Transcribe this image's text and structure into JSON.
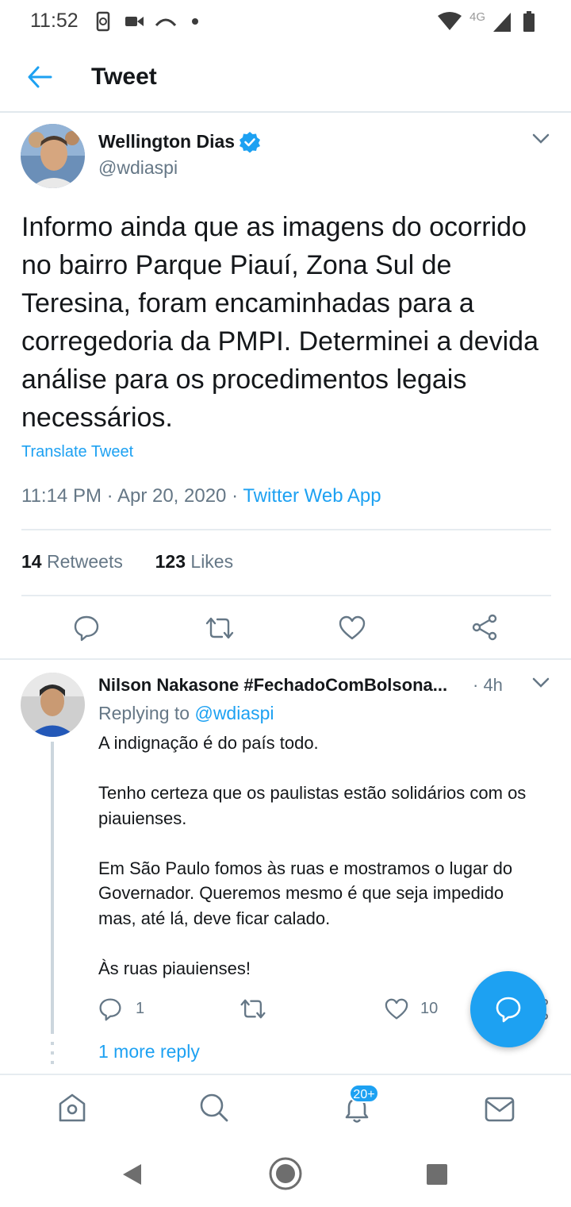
{
  "status_bar": {
    "time": "11:52",
    "network": "4G",
    "icons": [
      "sync-icon",
      "video-icon",
      "cast-icon",
      "dot-icon",
      "wifi-icon",
      "signal-icon",
      "battery-icon"
    ]
  },
  "header": {
    "back_icon": "arrow-left-icon",
    "title": "Tweet"
  },
  "tweet": {
    "author_name": "Wellington Dias",
    "verified": true,
    "handle": "@wdiaspi",
    "text": "Informo ainda que as imagens do ocorrido no bairro Parque Piauí, Zona Sul de Teresina, foram encaminhadas para a corregedoria da PMPI. Determinei a devida análise para os procedimentos legais necessários.",
    "translate_label": "Translate Tweet",
    "time": "11:14 PM",
    "date": "Apr 20, 2020",
    "separator": "·",
    "source": "Twitter Web App",
    "retweets_count": "14",
    "retweets_label": "Retweets",
    "likes_count": "123",
    "likes_label": "Likes"
  },
  "reply": {
    "author_name": "Nilson Nakasone #FechadoComBolsona...",
    "time": "· 4h",
    "replying_prefix": "Replying to",
    "replying_handle": "@wdiaspi",
    "text": "A indignação é do país todo.\n\nTenho certeza que os paulistas estão solidários com os piauienses.\n\nEm São Paulo fomos às ruas e mostramos o lugar do Governador. Queremos mesmo é que seja impedido mas, até lá, deve ficar calado.\n\nÀs ruas piauienses!",
    "reply_count": "1",
    "like_count": "10",
    "more_replies": "1 more reply"
  },
  "bottom_nav": {
    "items": [
      "home-icon",
      "search-icon",
      "notifications-icon",
      "messages-icon"
    ],
    "notifications_badge": "20+"
  },
  "colors": {
    "accent": "#1da1f2",
    "text": "#14171a",
    "secondary": "#657786",
    "divider": "#e6ecf0"
  }
}
